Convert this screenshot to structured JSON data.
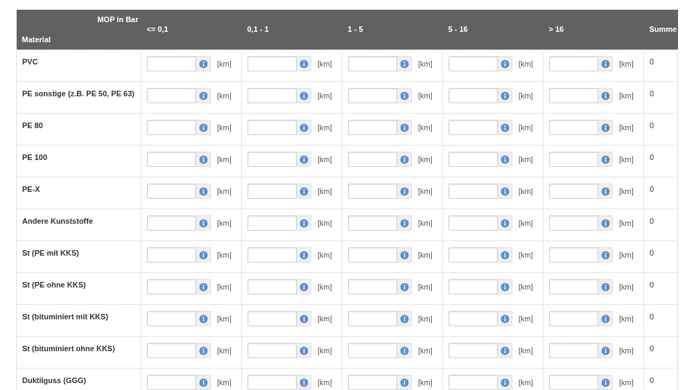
{
  "table": {
    "header": {
      "material_label": "Material",
      "mop_label": "MOP in Bar",
      "pressure_columns": [
        "<= 0,1",
        "0,1 - 1",
        "1 - 5",
        "5 - 16",
        "> 16"
      ],
      "sum_label": "Summe"
    },
    "rows": [
      {
        "material": "PVC",
        "units": [
          "[km]",
          "[km]",
          "[km]",
          "[km]",
          "[km]"
        ],
        "sum": "0"
      },
      {
        "material": "PE sonstige (z.B. PE 50, PE 63)",
        "units": [
          "[km]",
          "[km]",
          "[km]",
          "[km]",
          "[km]"
        ],
        "sum": "0"
      },
      {
        "material": "PE 80",
        "units": [
          "[km]",
          "[km]",
          "[km]",
          "[km]",
          "[km]"
        ],
        "sum": "0"
      },
      {
        "material": "PE 100",
        "units": [
          "[km]",
          "[km]",
          "[km]",
          "[km]",
          "[km]"
        ],
        "sum": "0"
      },
      {
        "material": "PE-X",
        "units": [
          "[km]",
          "[km]",
          "[km]",
          "[km]",
          "[km]"
        ],
        "sum": "0"
      },
      {
        "material": "Andere Kunststoffe",
        "units": [
          "[km]",
          "[km]",
          "[km]",
          "[km]",
          "[km]"
        ],
        "sum": "0"
      },
      {
        "material": "St (PE mit KKS)",
        "units": [
          "[km]",
          "[km]",
          "[km]",
          "[km]",
          "[km]"
        ],
        "sum": "0"
      },
      {
        "material": "St (PE ohne KKS)",
        "units": [
          "[km]",
          "[km]",
          "[km]",
          "[km]",
          "[km]"
        ],
        "sum": "0"
      },
      {
        "material": "St (bituminiert mit KKS)",
        "units": [
          "[km]",
          "[km]",
          "[km]",
          "[km]",
          "[km]"
        ],
        "sum": "0"
      },
      {
        "material": "St (bituminiert ohne KKS)",
        "units": [
          "[km]",
          "[km]",
          "[km]",
          "[km]",
          "[km]"
        ],
        "sum": "0"
      },
      {
        "material": "Duktilguss (GGG)",
        "units": [
          "[km]",
          "[km]",
          "[km]",
          "[km]",
          "[km]"
        ],
        "sum": "0"
      }
    ]
  }
}
